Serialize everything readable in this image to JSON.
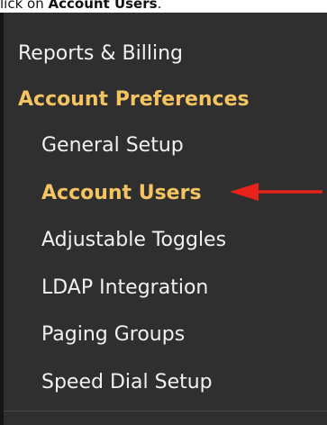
{
  "caption": {
    "prefix": "lick on ",
    "emphasis": "Account Users",
    "suffix": "."
  },
  "menu": {
    "top_item": "Reports & Billing",
    "section_heading": "Account Preferences",
    "sub_items": [
      "General Setup",
      "Account Users",
      "Adjustable Toggles",
      "LDAP Integration",
      "Paging Groups",
      "Speed Dial Setup"
    ],
    "active_item": "Account Users"
  },
  "colors": {
    "panel_background": "#2f2f2f",
    "menu_text": "#f1f1f1",
    "accent": "#f5c462",
    "annotation_arrow": "#e8231c"
  },
  "annotation": {
    "icon": "left-arrow-icon"
  }
}
